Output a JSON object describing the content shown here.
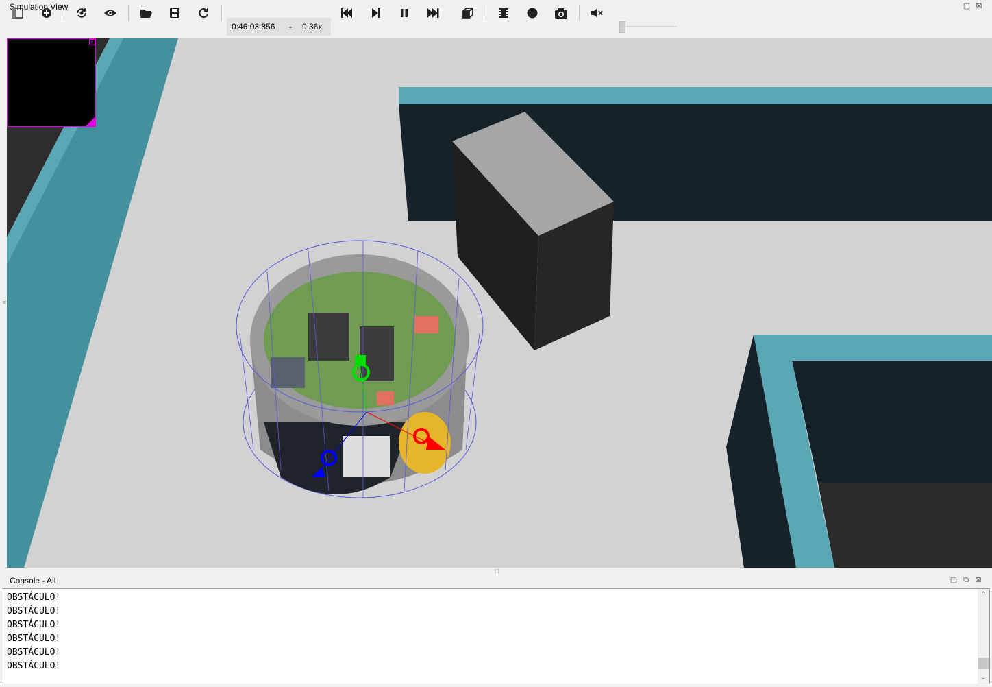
{
  "window": {
    "title": "Simulation View"
  },
  "toolbar": {
    "buttons": [
      {
        "name": "toggle-scene-tree",
        "icon": "panel-icon"
      },
      {
        "name": "add-node",
        "icon": "plus-circle-icon"
      },
      {
        "name": "change-viewpoint",
        "icon": "rotate-view-icon"
      },
      {
        "name": "view-options",
        "icon": "eye-icon"
      },
      {
        "name": "open-world",
        "icon": "folder-open-icon"
      },
      {
        "name": "save-world",
        "icon": "save-icon"
      },
      {
        "name": "reload-world",
        "icon": "reload-icon"
      },
      {
        "name": "reset-simulation",
        "icon": "skip-back-icon"
      },
      {
        "name": "step",
        "icon": "step-icon"
      },
      {
        "name": "pause",
        "icon": "pause-icon"
      },
      {
        "name": "fast-forward",
        "icon": "fast-forward-icon"
      },
      {
        "name": "rendering",
        "icon": "cube-icon"
      },
      {
        "name": "record-movie",
        "icon": "film-icon"
      },
      {
        "name": "record-animation",
        "icon": "record-icon"
      },
      {
        "name": "screenshot",
        "icon": "camera-icon"
      },
      {
        "name": "mute",
        "icon": "speaker-muted-icon"
      }
    ],
    "simulation_time": "0:46:03:856",
    "time_separator": "-",
    "speed": "0.36x",
    "volume_level": 0
  },
  "console": {
    "title": "Console - All",
    "lines": [
      "OBSTÁCULO!",
      "OBSTÁCULO!",
      "OBSTÁCULO!",
      "OBSTÁCULO!",
      "OBSTÁCULO!",
      "OBSTÁCULO!"
    ]
  },
  "colors": {
    "floor": "#d2d2d2",
    "wall_top": "#5aa8b6",
    "wall_dark": "#15222a",
    "overlay_border": "#e000e0"
  }
}
